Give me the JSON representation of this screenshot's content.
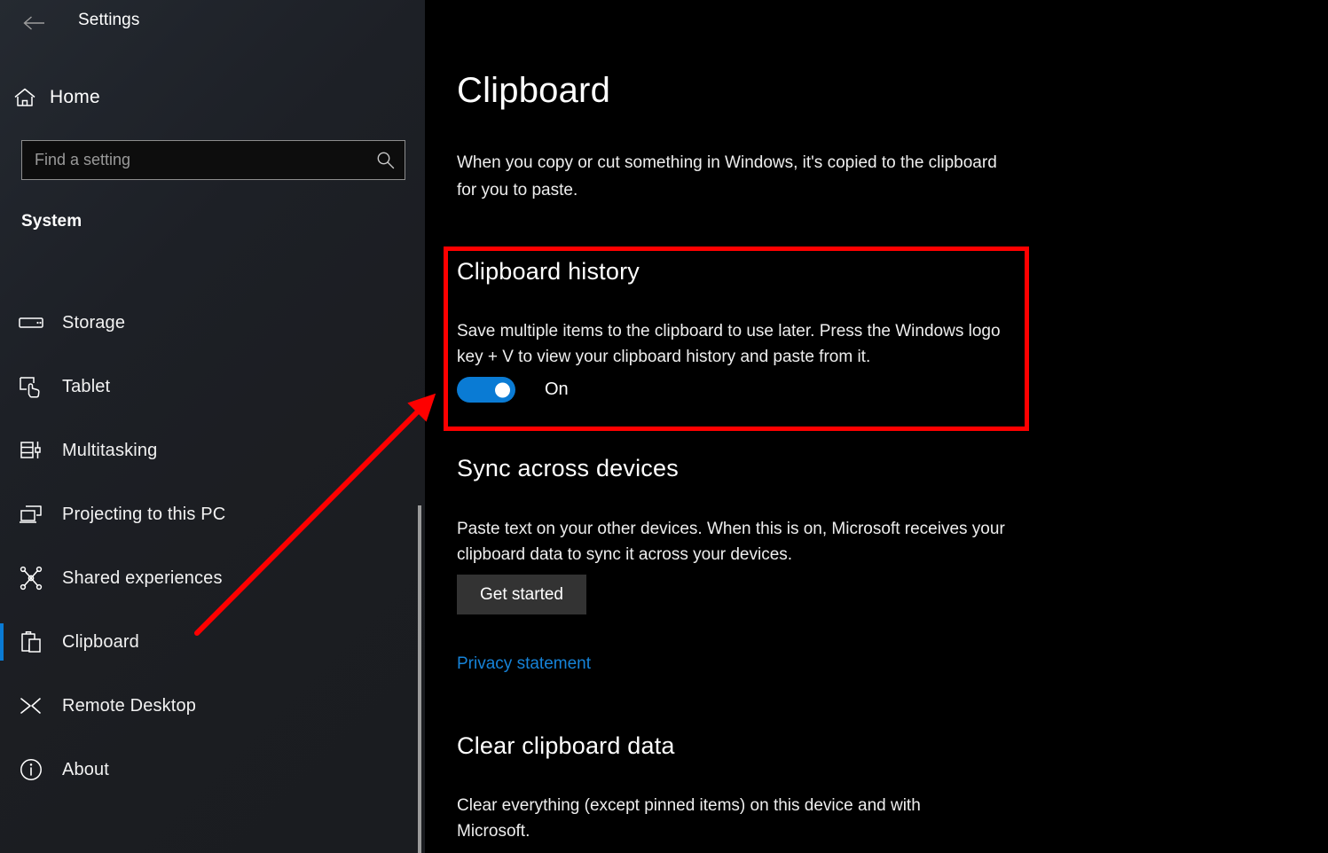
{
  "window": {
    "app_title": "Settings",
    "back_icon": "back-arrow-icon"
  },
  "sidebar": {
    "home": {
      "label": "Home",
      "icon": "home-icon"
    },
    "search": {
      "value": "",
      "placeholder": "Find a setting",
      "icon": "search-icon"
    },
    "group_label": "System",
    "items": [
      {
        "label": "Storage",
        "icon": "storage-drive-icon",
        "selected": false
      },
      {
        "label": "Tablet",
        "icon": "tablet-touch-icon",
        "selected": false
      },
      {
        "label": "Multitasking",
        "icon": "multitasking-icon",
        "selected": false
      },
      {
        "label": "Projecting to this PC",
        "icon": "projecting-screens-icon",
        "selected": false
      },
      {
        "label": "Shared experiences",
        "icon": "shared-network-icon",
        "selected": false
      },
      {
        "label": "Clipboard",
        "icon": "clipboard-icon",
        "selected": true
      },
      {
        "label": "Remote Desktop",
        "icon": "remote-desktop-icon",
        "selected": false
      },
      {
        "label": "About",
        "icon": "info-circle-icon",
        "selected": false
      }
    ]
  },
  "main": {
    "title": "Clipboard",
    "description": "When you copy or cut something in Windows, it's copied to the clipboard for you to paste.",
    "clipboard_history": {
      "heading": "Clipboard history",
      "description": "Save multiple items to the clipboard to use later. Press the Windows logo key + V to view your clipboard history and paste from it.",
      "toggle_state": "On"
    },
    "sync_across_devices": {
      "heading": "Sync across devices",
      "description": "Paste text on your other devices. When this is on, Microsoft receives your clipboard data to sync it across your devices.",
      "button_label": "Get started",
      "link_label": "Privacy statement"
    },
    "clear_clipboard_data": {
      "heading": "Clear clipboard data",
      "description": "Clear everything (except pinned items) on this device and with Microsoft."
    }
  },
  "annotations": {
    "highlight_color": "#fe0000",
    "accent_color": "#0a7bd4",
    "link_color": "#1683d8"
  }
}
